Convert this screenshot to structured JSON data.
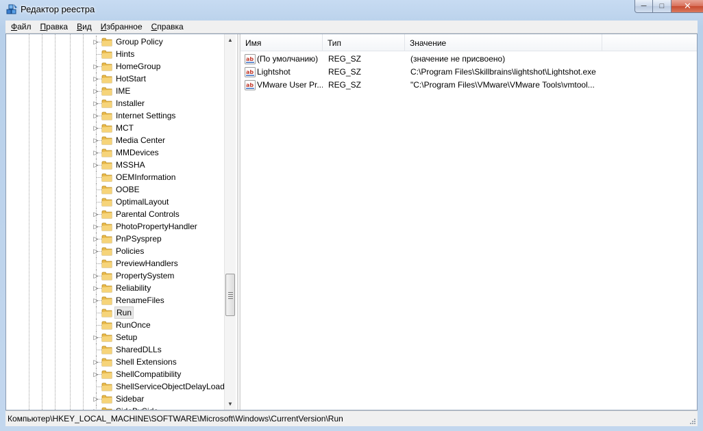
{
  "window": {
    "title": "Редактор реестра"
  },
  "menu": [
    {
      "label": "Файл",
      "key": "Ф",
      "rest": "айл"
    },
    {
      "label": "Правка",
      "key": "П",
      "rest": "равка"
    },
    {
      "label": "Вид",
      "key": "В",
      "rest": "ид"
    },
    {
      "label": "Избранное",
      "key": "И",
      "rest": "збранное"
    },
    {
      "label": "Справка",
      "key": "С",
      "rest": "правка"
    }
  ],
  "tree": {
    "items": [
      {
        "label": "Group Policy",
        "expandable": true
      },
      {
        "label": "Hints",
        "expandable": false
      },
      {
        "label": "HomeGroup",
        "expandable": true
      },
      {
        "label": "HotStart",
        "expandable": true
      },
      {
        "label": "IME",
        "expandable": true
      },
      {
        "label": "Installer",
        "expandable": true
      },
      {
        "label": "Internet Settings",
        "expandable": true
      },
      {
        "label": "MCT",
        "expandable": true
      },
      {
        "label": "Media Center",
        "expandable": true
      },
      {
        "label": "MMDevices",
        "expandable": true
      },
      {
        "label": "MSSHA",
        "expandable": true
      },
      {
        "label": "OEMInformation",
        "expandable": false
      },
      {
        "label": "OOBE",
        "expandable": false
      },
      {
        "label": "OptimalLayout",
        "expandable": false
      },
      {
        "label": "Parental Controls",
        "expandable": true
      },
      {
        "label": "PhotoPropertyHandler",
        "expandable": true
      },
      {
        "label": "PnPSysprep",
        "expandable": true
      },
      {
        "label": "Policies",
        "expandable": true
      },
      {
        "label": "PreviewHandlers",
        "expandable": false
      },
      {
        "label": "PropertySystem",
        "expandable": true
      },
      {
        "label": "Reliability",
        "expandable": true
      },
      {
        "label": "RenameFiles",
        "expandable": true
      },
      {
        "label": "Run",
        "expandable": false,
        "selected": true
      },
      {
        "label": "RunOnce",
        "expandable": false
      },
      {
        "label": "Setup",
        "expandable": true
      },
      {
        "label": "SharedDLLs",
        "expandable": false
      },
      {
        "label": "Shell Extensions",
        "expandable": true
      },
      {
        "label": "ShellCompatibility",
        "expandable": true
      },
      {
        "label": "ShellServiceObjectDelayLoad",
        "expandable": false
      },
      {
        "label": "Sidebar",
        "expandable": true
      },
      {
        "label": "SideBySide",
        "expandable": true
      }
    ]
  },
  "list": {
    "columns": [
      "Имя",
      "Тип",
      "Значение"
    ],
    "rows": [
      {
        "name": "(По умолчанию)",
        "type": "REG_SZ",
        "value": "(значение не присвоено)"
      },
      {
        "name": "Lightshot",
        "type": "REG_SZ",
        "value": "C:\\Program Files\\Skillbrains\\lightshot\\Lightshot.exe"
      },
      {
        "name": "VMware User Pr...",
        "type": "REG_SZ",
        "value": "\"C:\\Program Files\\VMware\\VMware Tools\\vmtool..."
      }
    ]
  },
  "status": {
    "path": "Компьютер\\HKEY_LOCAL_MACHINE\\SOFTWARE\\Microsoft\\Windows\\CurrentVersion\\Run"
  },
  "colors": {
    "folder": "#e8b84a",
    "titlebar": "#c7dbf2",
    "close": "#c74a2f"
  },
  "icons": {
    "app": "regedit-icon",
    "folder": "folder-icon",
    "value": "reg-sz-icon"
  }
}
